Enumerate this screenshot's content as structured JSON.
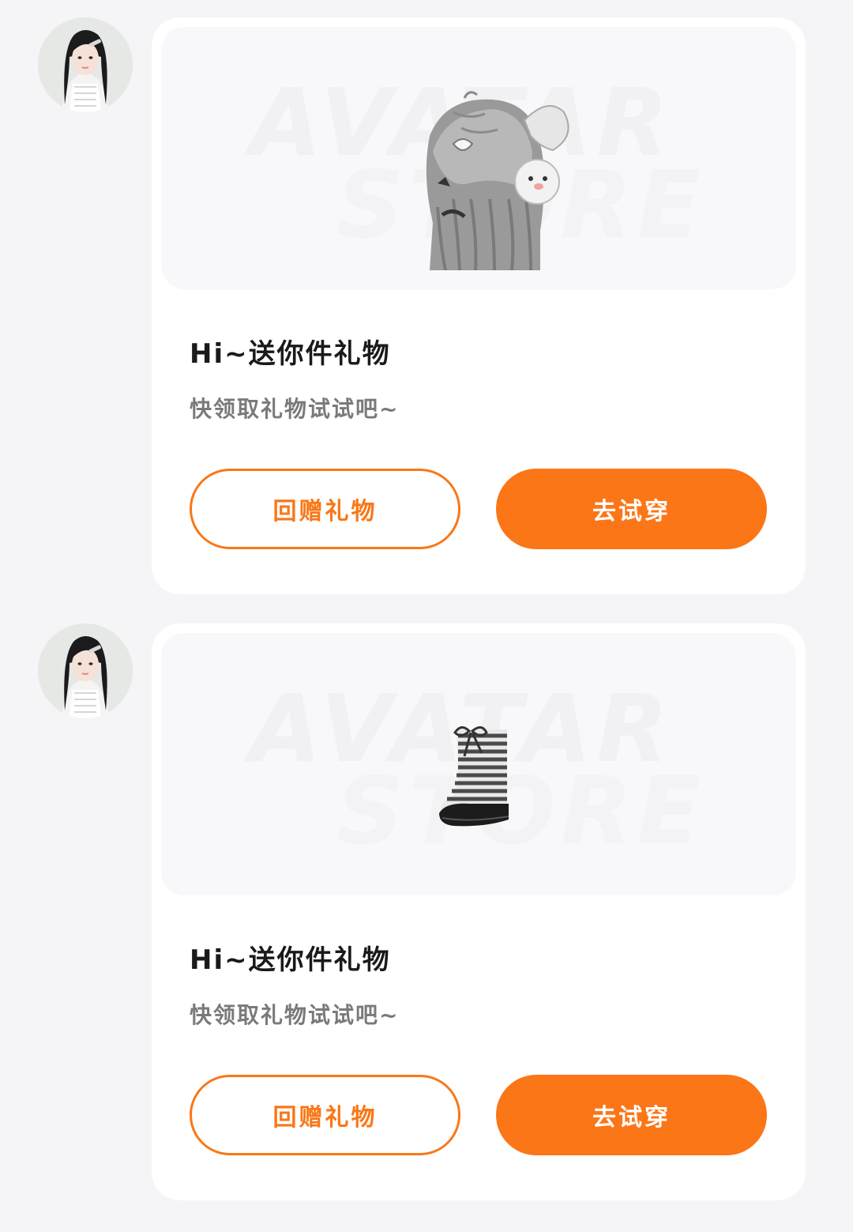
{
  "colors": {
    "accent": "#fb7616",
    "page_background": "#f5f5f7",
    "card_background": "#ffffff",
    "title_text": "#1a1a1a",
    "subtitle_text": "#7a7a7a"
  },
  "messages": [
    {
      "title": "Hi~送你件礼物",
      "subtitle": "快领取礼物试试吧~",
      "watermark_line1": "AVATAR",
      "watermark_line2": "STORE",
      "item_icon": "hair-accessory-icon",
      "return_gift_label": "回赠礼物",
      "try_on_label": "去试穿"
    },
    {
      "title": "Hi~送你件礼物",
      "subtitle": "快领取礼物试试吧~",
      "watermark_line1": "AVATAR",
      "watermark_line2": "STORE",
      "item_icon": "boot-icon",
      "return_gift_label": "回赠礼物",
      "try_on_label": "去试穿"
    }
  ]
}
